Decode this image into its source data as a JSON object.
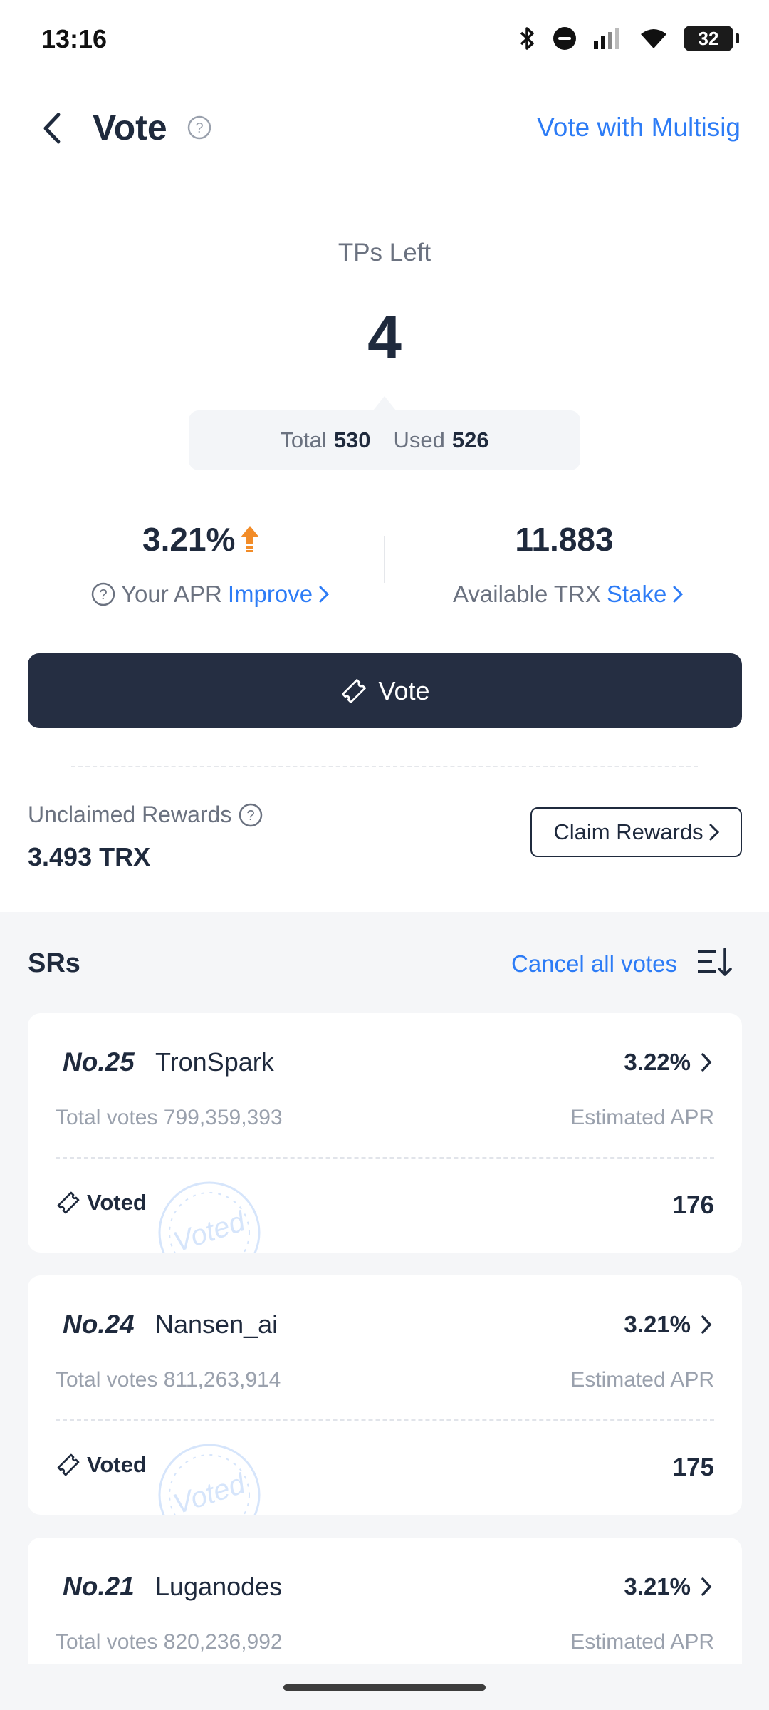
{
  "status_bar": {
    "time": "13:16",
    "battery": "32"
  },
  "header": {
    "title": "Vote",
    "multisig_link": "Vote with Multisig"
  },
  "tps": {
    "label": "TPs Left",
    "value": "4",
    "total_label": "Total",
    "total": "530",
    "used_label": "Used",
    "used": "526"
  },
  "apr": {
    "value": "3.21%",
    "label": "Your APR",
    "link": "Improve"
  },
  "trx": {
    "value": "11.883",
    "label": "Available TRX",
    "link": "Stake"
  },
  "vote_button": {
    "label": "Vote"
  },
  "rewards": {
    "label": "Unclaimed Rewards",
    "value": "3.493 TRX",
    "claim_label": "Claim Rewards"
  },
  "srs": {
    "title": "SRs",
    "cancel_label": "Cancel all votes",
    "total_votes_label": "Total votes",
    "estimated_apr_label": "Estimated APR",
    "voted_label": "Voted",
    "stamp_text": "Voted",
    "items": [
      {
        "rank": "No.25",
        "name": "TronSpark",
        "apr": "3.22%",
        "total_votes": "799,359,393",
        "my_votes": "176"
      },
      {
        "rank": "No.24",
        "name": "Nansen_ai",
        "apr": "3.21%",
        "total_votes": "811,263,914",
        "my_votes": "175"
      },
      {
        "rank": "No.21",
        "name": "Luganodes",
        "apr": "3.21%",
        "total_votes": "820,236,992"
      }
    ]
  },
  "colors": {
    "accent": "#2d7cf6",
    "primary_dark": "#252e42",
    "arrow_up": "#f28c28"
  }
}
